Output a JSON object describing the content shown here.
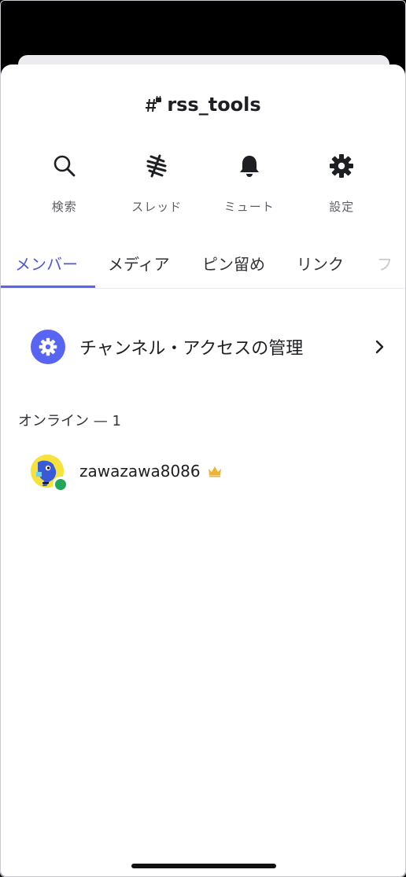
{
  "header": {
    "channel_name": "rss_tools"
  },
  "actions": [
    {
      "label": "検索",
      "icon": "search-icon"
    },
    {
      "label": "スレッド",
      "icon": "threads-icon"
    },
    {
      "label": "ミュート",
      "icon": "bell-icon"
    },
    {
      "label": "設定",
      "icon": "gear-icon"
    }
  ],
  "tabs": [
    {
      "label": "メンバー",
      "active": true
    },
    {
      "label": "メディア"
    },
    {
      "label": "ピン留め"
    },
    {
      "label": "リンク"
    },
    {
      "label": "フ"
    }
  ],
  "channel_access": {
    "label": "チャンネル・アクセスの管理"
  },
  "members": {
    "section_label": "オンライン — 1",
    "items": [
      {
        "username": "zawazawa8086",
        "status": "online",
        "owner": true
      }
    ]
  },
  "colors": {
    "accent": "#5865f2",
    "online": "#23a55a",
    "crown": "#f0b232"
  }
}
